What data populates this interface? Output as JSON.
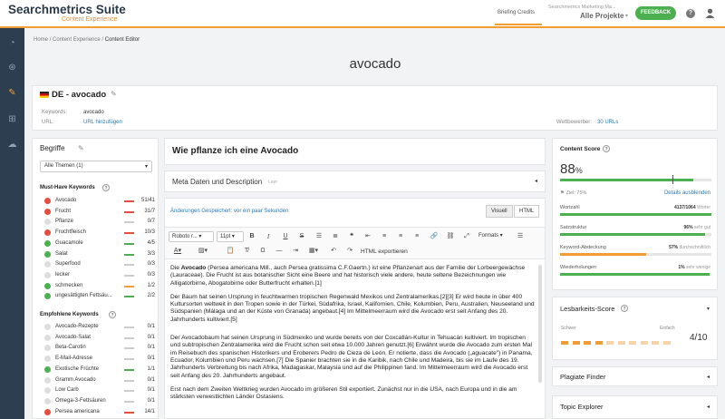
{
  "header": {
    "logo_main": "Searchmetrics Suite",
    "logo_sub": "Content Experience",
    "nav_item": "Briefing Credits",
    "project_org": "Searchmetrics Marketing Ma...",
    "project_name": "Alle Projekte",
    "feedback": "FEEDBACK",
    "help": "?"
  },
  "breadcrumb": {
    "home": "Home",
    "section": "Content Experience",
    "current": "Content Editor",
    "sep": "/"
  },
  "page_title": "avocado",
  "project": {
    "title": "DE - avocado",
    "keywords_label": "Keywords:",
    "keywords_value": "avocado",
    "url_label": "URL:",
    "url_value": "URL hinzufügen",
    "competitors_label": "Wettbewerber:",
    "competitors_value": "30 URLs"
  },
  "terms": {
    "title": "Begriffe",
    "filter": "Alle Themen (1)",
    "must_have_title": "Must-Have Keywords",
    "must_have": [
      {
        "name": "Avocado",
        "count": "51/41",
        "status": "red",
        "bar": "#e74c3c"
      },
      {
        "name": "Frucht",
        "count": "31/7",
        "status": "red",
        "bar": "#e74c3c"
      },
      {
        "name": "Pflanze",
        "count": "0/7",
        "status": "none",
        "bar": "#ccc"
      },
      {
        "name": "Fruchtfleisch",
        "count": "10/3",
        "status": "red",
        "bar": "#e74c3c"
      },
      {
        "name": "Guacamole",
        "count": "4/5",
        "status": "green",
        "bar": "#4caf50"
      },
      {
        "name": "Salat",
        "count": "3/3",
        "status": "green",
        "bar": "#4caf50"
      },
      {
        "name": "Superfood",
        "count": "0/3",
        "status": "none",
        "bar": "#ccc"
      },
      {
        "name": "lecker",
        "count": "0/3",
        "status": "none",
        "bar": "#ccc"
      },
      {
        "name": "schmecken",
        "count": "1/2",
        "status": "green",
        "bar": "#f39c33"
      },
      {
        "name": "ungesättigten Fettsäu...",
        "count": "2/2",
        "status": "green",
        "bar": "#4caf50"
      }
    ],
    "recommended_title": "Empfohlene Keywords",
    "recommended": [
      {
        "name": "Avocado-Rezepte",
        "count": "0/1",
        "status": "none",
        "bar": "#ccc"
      },
      {
        "name": "Avocado-Salat",
        "count": "0/1",
        "status": "none",
        "bar": "#ccc"
      },
      {
        "name": "Beta-Carotin",
        "count": "0/1",
        "status": "none",
        "bar": "#ccc"
      },
      {
        "name": "E-Mail-Adresse",
        "count": "0/1",
        "status": "none",
        "bar": "#ccc"
      },
      {
        "name": "Exotische Früchte",
        "count": "1/1",
        "status": "green",
        "bar": "#4caf50"
      },
      {
        "name": "Gramm Avocado",
        "count": "0/1",
        "status": "none",
        "bar": "#ccc"
      },
      {
        "name": "Low Carb",
        "count": "0/1",
        "status": "none",
        "bar": "#ccc"
      },
      {
        "name": "Omega-3-Fettsäuren",
        "count": "0/1",
        "status": "none",
        "bar": "#ccc"
      },
      {
        "name": "Persea americana",
        "count": "14/1",
        "status": "red",
        "bar": "#e74c3c"
      }
    ]
  },
  "editor": {
    "doc_title": "Wie pflanze ich eine Avocado",
    "meta_title": "Meta Daten und Description",
    "meta_sub": "Leer",
    "saved_text": "Änderungen Gespeichert: vor ein paar Sekunden",
    "tab_visual": "Visuell",
    "tab_html": "HTML",
    "font": "Roboto r...",
    "size": "11pt",
    "formats": "Formats",
    "html_export": "HTML exportieren",
    "para1_pre": "Die ",
    "para1_bold": "Avocado",
    "para1_rest": " (Persea americana Mill., auch Persea gratissima C.F.Gaertn.) ist eine Pflanzenart aus der Familie der Lorbeergewächse (Lauraceae). Die Frucht ist aus botanischer Sicht eine Beere und hat historisch viele andere, heute seltene Bezeichnungen wie Alligatorbirne, Abogatobirne oder Butterfrucht erhalten.[1]",
    "para2": "Der Baum hat seinen Ursprung in feuchtwarmen tropischen Regenwald Mexikos und Zentralamerikas.[2][3] Er wird heute in über 400 Kultursorten weltweit in den Tropen sowie in der Türkei, Südafrika, Israel, Kalifornien, Chile, Kolumbien, Peru, Australien, Neuseeland und Südspanien (Málaga und an der Küste von Granada) angebaut.[4] Im Mittelmeerraum wird die Avocado erst seit Anfang des 20. Jahrhunderts kultiviert.[5]",
    "para3": "Der Avocadobaum hat seinen Ursprung in Südmexiko und wurde bereits von der Coxcatlán-Kultur in Tehuacán kultiviert. Im tropischen und subtropischen Zentralamerika wird die Frucht schon seit etwa 10.000 Jahren genutzt.[6] Erwähnt wurde die Avocado zum ersten Mal im Reisebuch des spanischen Historikers und Eroberers Pedro de Cieza de León. Er notierte, dass die Avocado („aguacate\") in Panama, Ecuador, Kolumbien und Peru wachsen.[7] Die Spanier brachten sie in die Karibik, nach Chile und Madeira, bis sie im Laufe des 19. Jahrhunderts Verbreitung bis nach Afrika, Madagaskar, Malaysia und auf die Philippinen fand. Im Mittelmeerraum wird die Avocado erst seit Anfang des 20. Jahrhunderts angebaut.",
    "para4": "Erst nach dem Zweiten Weltkrieg wurden Avocado im größeren Stil exportiert. Zunächst nur in die USA, nach Europa und in die am stärksten verwestlichten Länder Ostasiens."
  },
  "score": {
    "title": "Content Score",
    "value": "88",
    "unit": "%",
    "value_pct": 88,
    "goal": "Ziel: 75%",
    "details": "Details ausblenden",
    "metrics": [
      {
        "label": "Wortzahl",
        "value": "4137/1064",
        "note": "Wörter",
        "pct": 100,
        "color": "#4caf50"
      },
      {
        "label": "Satzstruktur",
        "value": "96%",
        "note": "sehr gut",
        "pct": 96,
        "color": "#4caf50"
      },
      {
        "label": "Keyword-Abdeckung",
        "value": "57%",
        "note": "durchschnittlich",
        "pct": 57,
        "color": "#f39c33"
      },
      {
        "label": "Wiederholungen",
        "value": "1%",
        "note": "sehr wenige",
        "pct": 99,
        "color": "#4caf50"
      }
    ],
    "colors": {
      "good": "#4caf50",
      "mid": "#f39c33",
      "bad": "#e74c3c"
    }
  },
  "readability": {
    "title": "Lesbarkeits-Score",
    "left": "Schwer",
    "right": "Einfach",
    "value": "4/10",
    "filled": 4,
    "total": 10
  },
  "panels": {
    "plagiat": "Plagiate Finder",
    "topic": "Topic Explorer"
  }
}
